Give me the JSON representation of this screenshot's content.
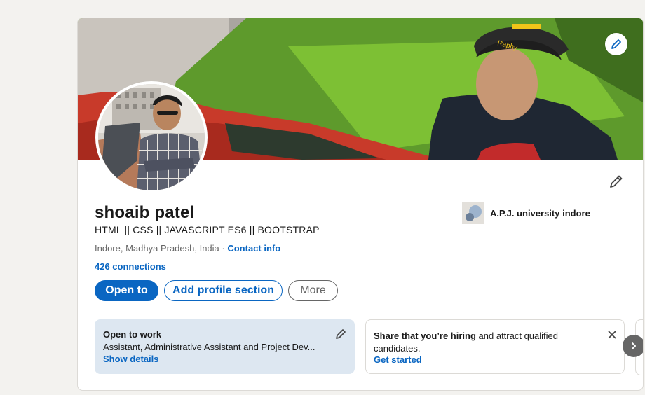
{
  "profile": {
    "name": "shoaib patel",
    "headline": "HTML || CSS || JAVASCRIPT ES6 || BOOTSTRAP",
    "location": "Indore, Madhya Pradesh, India",
    "location_separator": " · ",
    "contact_info_label": "Contact info",
    "connections": "426 connections",
    "education": "A.P.J. university indore"
  },
  "actions": {
    "open_to_label": "Open to",
    "add_section_label": "Add profile section",
    "more_label": "More"
  },
  "open_to_work": {
    "title": "Open to work",
    "roles": "Assistant, Administrative Assistant and Project Dev...",
    "link": "Show details"
  },
  "hiring": {
    "bold_text": "Share that you’re hiring",
    "rest_text": " and attract qualified candidates.",
    "link": "Get started"
  },
  "banner_cap_text": "Raphy",
  "icons": {
    "banner_edit": "pencil-icon",
    "intro_edit": "pencil-icon",
    "otw_edit": "pencil-icon",
    "close": "close-icon",
    "next": "chevron-right-icon"
  },
  "colors": {
    "accent": "#0a66c2",
    "open_to_work_bg": "#dde7f1",
    "page_bg": "#f3f2ef"
  }
}
